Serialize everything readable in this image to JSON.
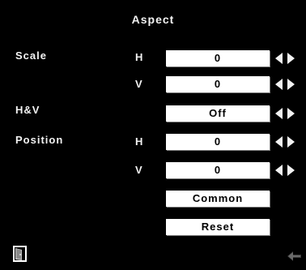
{
  "menu": {
    "title": "Aspect"
  },
  "rows": {
    "scale_label": "Scale",
    "scale_h_sub": "H",
    "scale_h_value": "0",
    "scale_v_sub": "V",
    "scale_v_value": "0",
    "hv_label": "H&V",
    "hv_value": "Off",
    "position_label": "Position",
    "position_h_sub": "H",
    "position_h_value": "0",
    "position_v_sub": "V",
    "position_v_value": "0"
  },
  "buttons": {
    "common_label": "Common",
    "reset_label": "Reset"
  },
  "icons": {
    "adjust_arrows": "left-right-arrows-icon",
    "exit_door": "door-exit-icon",
    "return": "return-arrow-icon"
  },
  "colors": {
    "background": "#000000",
    "text": "#f2f2f2",
    "box_fill": "#ffffff",
    "box_text": "#000000"
  }
}
